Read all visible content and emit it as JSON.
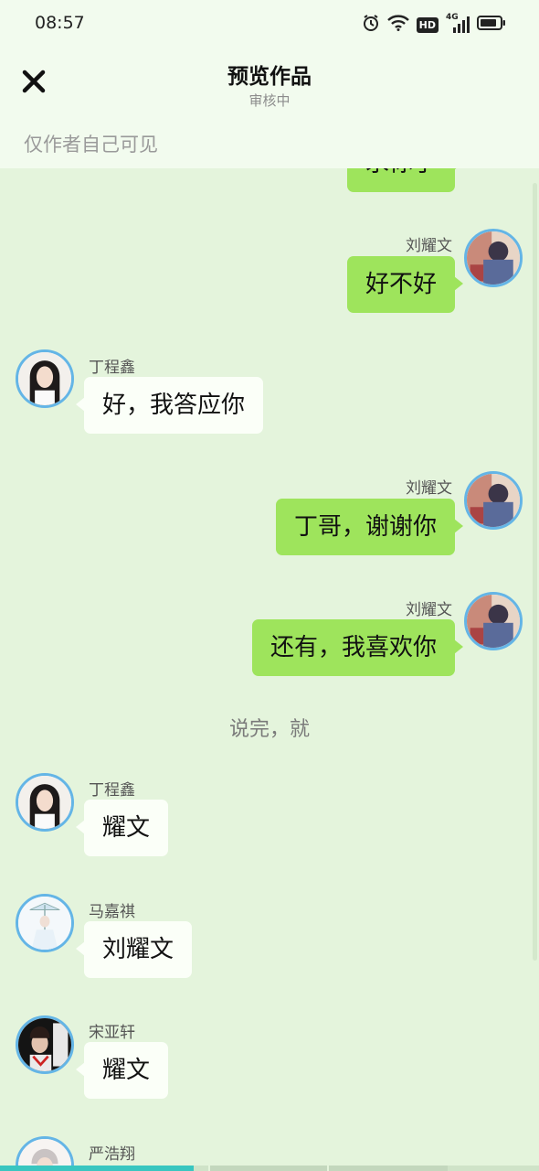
{
  "status_bar": {
    "time": "08:57",
    "network": "4G",
    "hd_label": "HD"
  },
  "header": {
    "title": "预览作品",
    "subtitle": "审核中",
    "close_icon": "close-icon"
  },
  "privacy_note": "仅作者自己可见",
  "messages": [
    {
      "side": "right",
      "sender": "",
      "text": "求你了",
      "partial": true
    },
    {
      "side": "right",
      "sender": "刘耀文",
      "text": "好不好"
    },
    {
      "side": "left",
      "sender": "丁程鑫",
      "text": "好，我答应你"
    },
    {
      "side": "right",
      "sender": "刘耀文",
      "text": "丁哥，谢谢你"
    },
    {
      "side": "right",
      "sender": "刘耀文",
      "text": "还有，我喜欢你"
    },
    {
      "type": "narration",
      "text": "说完，就"
    },
    {
      "side": "left",
      "sender": "丁程鑫",
      "text": "耀文"
    },
    {
      "side": "left",
      "sender": "马嘉祺",
      "text": "刘耀文"
    },
    {
      "side": "left",
      "sender": "宋亚轩",
      "text": "耀文"
    },
    {
      "side": "left",
      "sender": "严浩翔",
      "text": ""
    }
  ],
  "colors": {
    "my_bubble": "#9ee45c",
    "other_bubble": "#fbfff8",
    "background": "#e4f4dc",
    "avatar_ring": "#64b5e6",
    "progress": "#39c6c0"
  },
  "progress": {
    "fraction": 0.36
  }
}
